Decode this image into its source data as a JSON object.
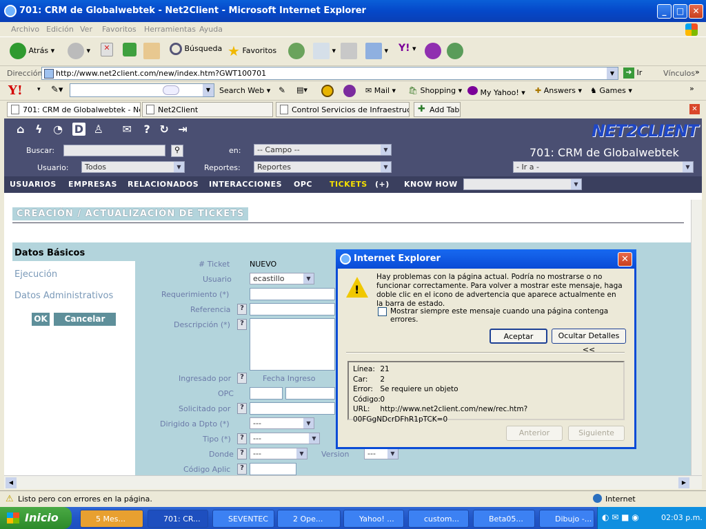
{
  "window": {
    "title": "701: CRM de Globalwebtek - Net2Client - Microsoft Internet Explorer"
  },
  "menu": [
    "Archivo",
    "Edición",
    "Ver",
    "Favoritos",
    "Herramientas",
    "Ayuda"
  ],
  "toolbar": {
    "back": "Atrás",
    "search": "Búsqueda",
    "favorites": "Favoritos"
  },
  "address": {
    "label": "Dirección",
    "url": "http://www.net2client.com/new/index.htm?GWT100701",
    "go": "Ir",
    "links": "Vínculos"
  },
  "yahoo_bar": {
    "search_web": "Search Web",
    "mail": "Mail",
    "shopping": "Shopping",
    "my_yahoo": "My Yahoo!",
    "answers": "Answers",
    "games": "Games"
  },
  "tabs": [
    "701: CRM de Globalwebtek - Ne...",
    "Net2Client",
    "Control Servicios de Infraestruc...",
    "Add Tab"
  ],
  "crm": {
    "logo": "NET2CLIENT",
    "company": "701: CRM de Globalwebtek",
    "buscar_label": "Buscar:",
    "en_label": "en:",
    "campo_value": "-- Campo --",
    "usuario_label": "Usuario:",
    "usuario_value": "Todos",
    "reportes_label": "Reportes:",
    "reportes_value": "Reportes",
    "ira_value": "- Ir a -",
    "nav": [
      "USUARIOS",
      "EMPRESAS",
      "RELACIONADOS",
      "INTERACCIONES",
      "OPC",
      "TICKETS",
      "(+)",
      "KNOW HOW"
    ],
    "section_title": "CREACIÓN / ACTUALIZACIÓN DE TICKETS",
    "left_tabs": [
      "Datos Básicos",
      "Ejecución",
      "Datos Administrativos"
    ],
    "ok": "OK",
    "cancel": "Cancelar",
    "form": {
      "ticket_label": "# Ticket",
      "ticket_value": "NUEVO",
      "usuario_label": "Usuario",
      "usuario_value": "ecastillo",
      "requerimiento_label": "Requerimiento (*)",
      "referencia_label": "Referencia",
      "descripcion_label": "Descripción (*)",
      "ingresado_label": "Ingresado por",
      "fecha_label": "Fecha Ingreso",
      "opc_label": "OPC",
      "solicitado_label": "Solicitado por",
      "dirigido_label": "Dirigido a Dpto (*)",
      "dirigido_value": "---",
      "tipo_label": "Tipo (*)",
      "tipo_value": "---",
      "donde_label": "Donde",
      "donde_value": "---",
      "version_label": "Version",
      "version_value": "---",
      "codigo_label": "Código Aplic"
    }
  },
  "dialog": {
    "title": "Internet Explorer",
    "message": "Hay problemas con la página actual. Podría no mostrarse o no funcionar correctamente. Para volver a mostrar este mensaje, haga doble clic en el icono de advertencia que aparece actualmente en la barra de estado.",
    "checkbox": "Mostrar siempre este mensaje cuando una página contenga errores.",
    "accept": "Aceptar",
    "hide_details": "Ocultar Detalles <<",
    "details": [
      {
        "k": "Línea:",
        "v": "21"
      },
      {
        "k": "Car:",
        "v": "2"
      },
      {
        "k": "Error:",
        "v": "Se requiere un objeto"
      },
      {
        "k": "Código:",
        "v": "0"
      },
      {
        "k": "URL:",
        "v": "http://www.net2client.com/new/rec.htm?00FGgNDcrDFhR1pTCK=0"
      }
    ],
    "prev": "Anterior",
    "next": "Siguiente"
  },
  "status": {
    "text": "Listo pero con errores en la página.",
    "zone": "Internet"
  },
  "taskbar": {
    "start": "Inicio",
    "tasks": [
      "5 Mes...",
      "701: CR...",
      "SEVENTEC",
      "2 Ope...",
      "Yahoo! ...",
      "custom...",
      "Beta05...",
      "Dibujo -..."
    ],
    "clock": "02:03 p.m."
  }
}
